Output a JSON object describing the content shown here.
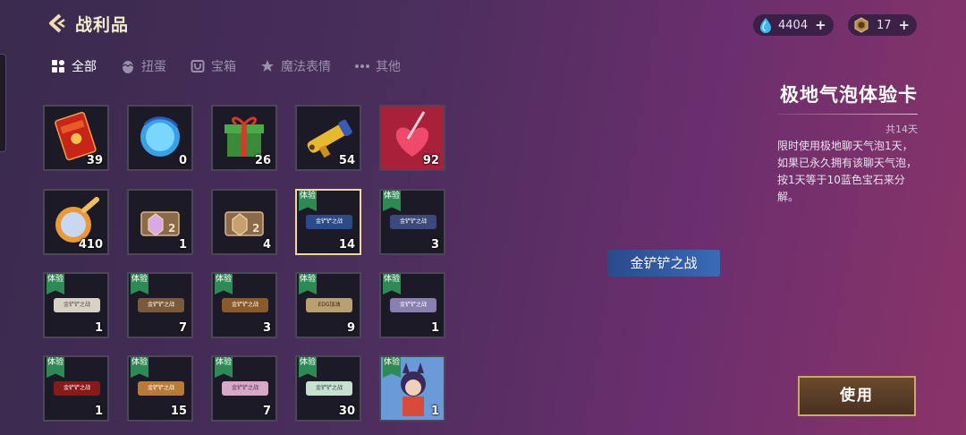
{
  "header": {
    "title": "战利品"
  },
  "currency": [
    {
      "icon": "blue-gem-icon",
      "value": "4404",
      "plus": "+"
    },
    {
      "icon": "gold-token-icon",
      "value": "17",
      "plus": "+"
    }
  ],
  "tabs": [
    {
      "label": "全部",
      "icon": "grid-icon",
      "active": true
    },
    {
      "label": "扭蛋",
      "icon": "egg-icon",
      "active": false
    },
    {
      "label": "宝箱",
      "icon": "chest-icon",
      "active": false
    },
    {
      "label": "魔法表情",
      "icon": "emote-icon",
      "active": false
    },
    {
      "label": "其他",
      "icon": "more-icon",
      "active": false
    }
  ],
  "items": [
    {
      "icon": "red-envelope-icon",
      "count": "39"
    },
    {
      "icon": "blue-orb-icon",
      "count": "0"
    },
    {
      "icon": "gift-box-icon",
      "count": "26"
    },
    {
      "icon": "golden-gun-icon",
      "count": "54"
    },
    {
      "icon": "red-heart-icon",
      "count": "92"
    },
    {
      "icon": "potion-icon",
      "count": "410"
    },
    {
      "icon": "rank-ticket-icon",
      "count": "1"
    },
    {
      "icon": "rank-ticket-icon",
      "count": "4"
    },
    {
      "icon": "chat-bubble-icon",
      "count": "14",
      "trial": "体验",
      "bubble_text": "金铲铲之战",
      "selected": true,
      "bubble_color": "#2a4a8a"
    },
    {
      "icon": "chat-bubble-icon",
      "count": "3",
      "trial": "体验",
      "bubble_text": "金铲铲之战",
      "bubble_color": "#3b4a7a"
    },
    {
      "icon": "chat-bubble-icon",
      "count": "1",
      "trial": "体验",
      "bubble_text": "金铲铲之战",
      "bubble_color": "#d8d2c6"
    },
    {
      "icon": "chat-bubble-icon",
      "count": "7",
      "trial": "体验",
      "bubble_text": "金铲铲之战",
      "bubble_color": "#7a5a3a"
    },
    {
      "icon": "chat-bubble-icon",
      "count": "3",
      "trial": "体验",
      "bubble_text": "金铲铲之战",
      "bubble_color": "#8a5a2a"
    },
    {
      "icon": "chat-bubble-icon",
      "count": "9",
      "trial": "体验",
      "bubble_text": "EDG加油",
      "bubble_color": "#b8a070"
    },
    {
      "icon": "chat-bubble-icon",
      "count": "1",
      "trial": "体验",
      "bubble_text": "金铲铲之战",
      "bubble_color": "#8a80b0"
    },
    {
      "icon": "chat-bubble-icon",
      "count": "1",
      "trial": "体验",
      "bubble_text": "金铲铲之战",
      "bubble_color": "#8a1a1a"
    },
    {
      "icon": "chat-bubble-icon",
      "count": "15",
      "trial": "体验",
      "bubble_text": "金铲铲之战",
      "bubble_color": "#b87a3a"
    },
    {
      "icon": "chat-bubble-icon",
      "count": "7",
      "trial": "体验",
      "bubble_text": "金铲铲之战",
      "bubble_color": "#d8a8c8"
    },
    {
      "icon": "chat-bubble-icon",
      "count": "30",
      "trial": "体验",
      "bubble_text": "金铲铲之战",
      "bubble_color": "#c8e0d0"
    },
    {
      "icon": "hero-portrait-icon",
      "count": "1",
      "trial": "体验"
    }
  ],
  "preview": {
    "bubble_text": "金铲铲之战"
  },
  "detail": {
    "title": "极地气泡体验卡",
    "total": "共14天",
    "description": "限时使用极地聊天气泡1天，如果已永久拥有该聊天气泡，按1天等于10蓝色宝石来分解。"
  },
  "use_button": "使用"
}
